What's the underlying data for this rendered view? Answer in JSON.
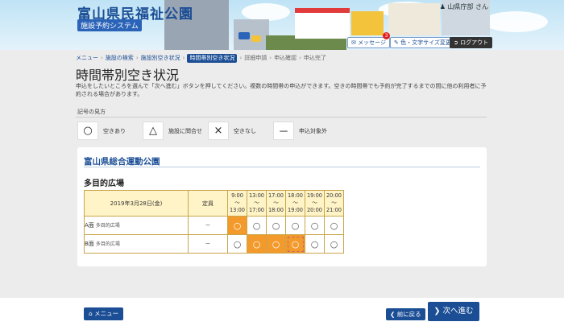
{
  "header": {
    "title": "富山県民福祉公園",
    "subtitle": "施設予約システム",
    "user": "山県庁部 さん",
    "buttons": [
      {
        "label": "メッセージ"
      },
      {
        "label": "色・文字サイズ変更"
      },
      {
        "label": "ログアウト"
      }
    ],
    "message_count": "3"
  },
  "breadcrumb": [
    {
      "label": "メニュー"
    },
    {
      "label": "施設の検索"
    },
    {
      "label": "施設別空き状況"
    },
    {
      "label": "時間帯別空き状況"
    },
    {
      "label": "詳細申請"
    },
    {
      "label": "申込確認"
    },
    {
      "label": "申込完了"
    }
  ],
  "page": {
    "title": "時間帯別空き状況",
    "intro": "申込をしたいところを選んで「次へ進む」ボタンを押してください。複数の時間帯の申込ができます。空きの時間帯でも予約が完了するまでの間に他の利用者に予約される場合があります。"
  },
  "legend": {
    "title": "記号の見方",
    "items": [
      {
        "symbol": "○",
        "label": "空きあり"
      },
      {
        "symbol": "△",
        "label": "施設に問合せ"
      },
      {
        "symbol": "×",
        "label": "空きなし"
      },
      {
        "symbol": "－",
        "label": "申込対象外"
      }
    ]
  },
  "facility": {
    "name": "富山県総合運動公園",
    "room": "多目的広場",
    "table": {
      "date": "2019年3月28日(金)",
      "capacity_header": "定員",
      "slots": [
        {
          "from": "9:00",
          "to": "13:00"
        },
        {
          "from": "13:00",
          "to": "17:00"
        },
        {
          "from": "17:00",
          "to": "18:00"
        },
        {
          "from": "18:00",
          "to": "19:00"
        },
        {
          "from": "19:00",
          "to": "20:00"
        },
        {
          "from": "20:00",
          "to": "21:00"
        }
      ],
      "tilde": "～",
      "rows": [
        {
          "name": "A面",
          "sub": "多目的広場",
          "capacity": "－",
          "cells": [
            {
              "s": "○",
              "state": "selected"
            },
            {
              "s": "○",
              "state": "open"
            },
            {
              "s": "○",
              "state": "open"
            },
            {
              "s": "○",
              "state": "open"
            },
            {
              "s": "○",
              "state": "open"
            },
            {
              "s": "○",
              "state": "open"
            }
          ]
        },
        {
          "name": "B面",
          "sub": "多目的広場",
          "capacity": "－",
          "cells": [
            {
              "s": "○",
              "state": "open"
            },
            {
              "s": "○",
              "state": "selected"
            },
            {
              "s": "○",
              "state": "selected"
            },
            {
              "s": "○",
              "state": "selected-dashed"
            },
            {
              "s": "○",
              "state": "open"
            },
            {
              "s": "○",
              "state": "open"
            }
          ]
        }
      ]
    }
  },
  "footer": {
    "menu": "メニュー",
    "back": "前に戻る",
    "next": "次へ進む"
  },
  "colors": {
    "primary": "#1b4e95",
    "selected": "#f39a2c",
    "table_header": "#fff4c7"
  }
}
